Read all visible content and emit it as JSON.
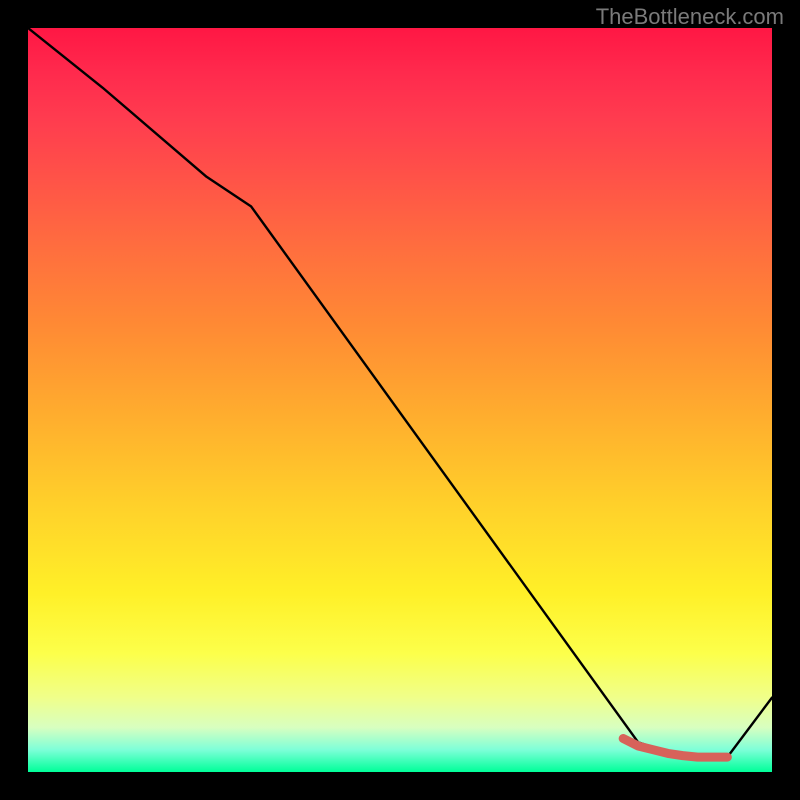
{
  "watermark": "TheBottleneck.com",
  "chart_data": {
    "type": "line",
    "title": "",
    "xlabel": "",
    "ylabel": "",
    "xlim": [
      0,
      100
    ],
    "ylim": [
      0,
      100
    ],
    "series": [
      {
        "name": "main-curve",
        "color": "#000000",
        "x": [
          0,
          10,
          24,
          30,
          82,
          88,
          94,
          100
        ],
        "y": [
          100,
          92,
          80,
          76,
          4,
          2,
          2,
          10
        ]
      },
      {
        "name": "highlight-segment",
        "color": "#d7625a",
        "x": [
          80,
          82,
          84,
          86,
          88,
          90,
          92,
          94
        ],
        "y": [
          4.5,
          3.5,
          3,
          2.5,
          2.2,
          2,
          2,
          2
        ]
      }
    ],
    "grid": false,
    "legend": false
  }
}
